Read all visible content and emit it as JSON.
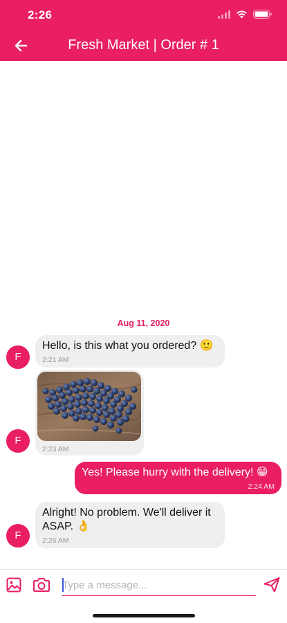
{
  "status_bar": {
    "time": "2:26"
  },
  "header": {
    "title": "Fresh Market | Order # 1",
    "back_icon": "arrow-left-icon"
  },
  "theme": {
    "accent": "#e91e63",
    "bubble_in": "#efefef"
  },
  "chat": {
    "date": "Aug 11, 2020",
    "messages": [
      {
        "sender": "incoming",
        "avatar": "F",
        "text": "Hello, is this what you ordered? 🙂",
        "time": "2:21 AM"
      },
      {
        "sender": "incoming",
        "avatar": "F",
        "type": "image",
        "image_desc": "blueberries",
        "time": "2:23 AM"
      },
      {
        "sender": "outgoing",
        "text": "Yes! Please hurry with the delivery! 😁",
        "time": "2:24 AM"
      },
      {
        "sender": "incoming",
        "avatar": "F",
        "text": "Alright! No problem. We'll deliver it ASAP. 👌",
        "time": "2:26 AM"
      }
    ]
  },
  "composer": {
    "placeholder": "Type a message...",
    "icons": [
      "image-icon",
      "camera-icon",
      "send-icon"
    ]
  }
}
